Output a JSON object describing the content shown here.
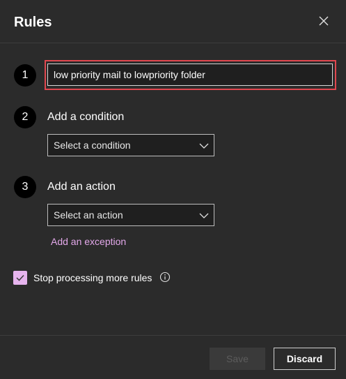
{
  "dialog": {
    "title": "Rules",
    "close_icon": "close-icon"
  },
  "steps": [
    {
      "number": "1",
      "name_value": "low priority mail to lowpriority folder"
    },
    {
      "number": "2",
      "label": "Add a condition",
      "dropdown_value": "Select a condition"
    },
    {
      "number": "3",
      "label": "Add an action",
      "dropdown_value": "Select an action",
      "link": "Add an exception"
    }
  ],
  "options": {
    "stop_processing_label": "Stop processing more rules",
    "stop_processing_checked": true,
    "info_icon": "info-icon"
  },
  "footer": {
    "save_label": "Save",
    "save_enabled": false,
    "discard_label": "Discard"
  },
  "colors": {
    "background": "#2b2b2b",
    "accent": "#e3a8ea",
    "highlight": "#e0474f",
    "step_circle": "#000000"
  }
}
